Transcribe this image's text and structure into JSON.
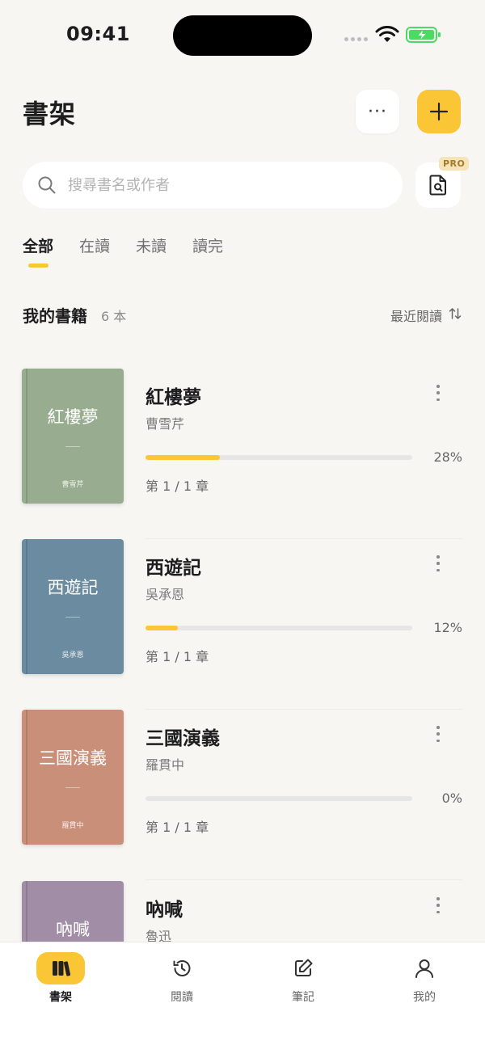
{
  "status_bar": {
    "time": "09:41"
  },
  "header": {
    "title": "書架",
    "more_label": "···"
  },
  "search": {
    "placeholder": "搜尋書名或作者",
    "pro_badge": "PRO"
  },
  "tabs": [
    {
      "label": "全部",
      "active": true
    },
    {
      "label": "在讀",
      "active": false
    },
    {
      "label": "未讀",
      "active": false
    },
    {
      "label": "讀完",
      "active": false
    }
  ],
  "section": {
    "title": "我的書籍",
    "count": "6 本",
    "sort_label": "最近閱讀"
  },
  "books": [
    {
      "title": "紅樓夢",
      "author": "曹雪芹",
      "progress": 0.28,
      "progress_label": "28%",
      "chapter": "第 1 / 1 章",
      "cover_color": "#98ad8f"
    },
    {
      "title": "西遊記",
      "author": "吳承恩",
      "progress": 0.12,
      "progress_label": "12%",
      "chapter": "第 1 / 1 章",
      "cover_color": "#6a8ba0"
    },
    {
      "title": "三國演義",
      "author": "羅貫中",
      "progress": 0,
      "progress_label": "0%",
      "chapter": "第 1 / 1 章",
      "cover_color": "#c98f78"
    },
    {
      "title": "吶喊",
      "author": "魯迅",
      "cover_color": "#a18ea6"
    }
  ],
  "bottom_nav": [
    {
      "label": "書架",
      "icon": "books-icon",
      "active": true
    },
    {
      "label": "閱讀",
      "icon": "history-icon",
      "active": false
    },
    {
      "label": "筆記",
      "icon": "edit-icon",
      "active": false
    },
    {
      "label": "我的",
      "icon": "user-icon",
      "active": false
    }
  ],
  "colors": {
    "accent": "#fac636",
    "background": "#f7f6f3"
  }
}
